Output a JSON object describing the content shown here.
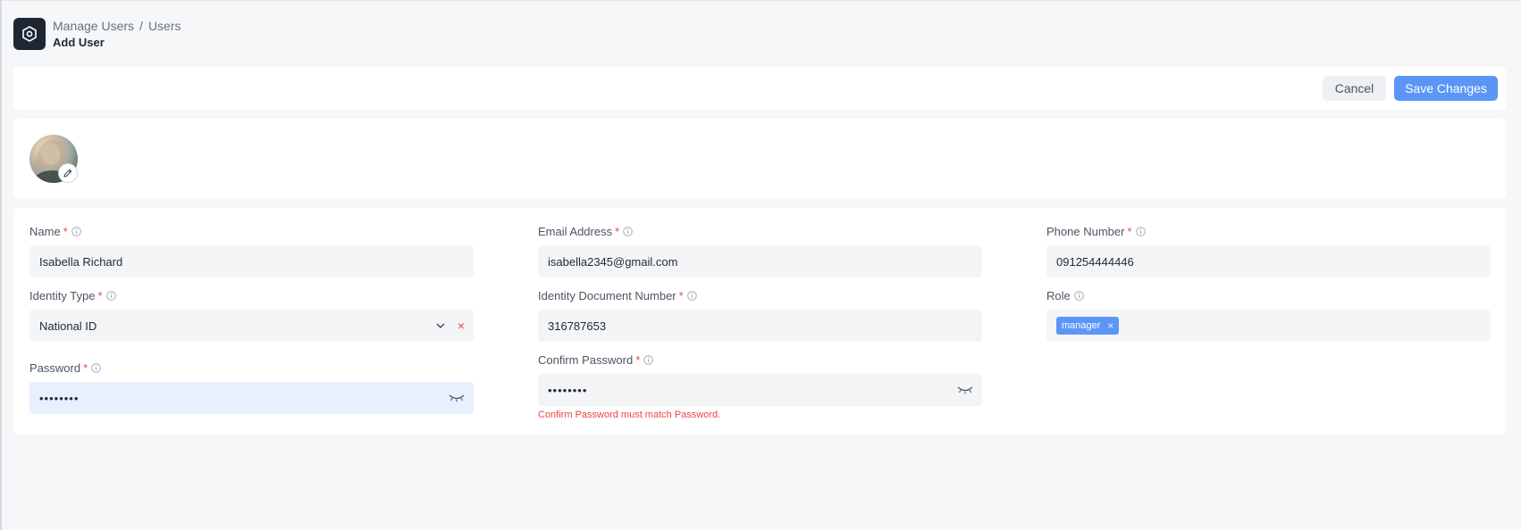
{
  "header": {
    "breadcrumb": [
      "Manage Users",
      "Users"
    ],
    "separator": "/",
    "title": "Add User"
  },
  "toolbar": {
    "cancel_label": "Cancel",
    "save_label": "Save Changes"
  },
  "form": {
    "required_mark": "*",
    "name": {
      "label": "Name",
      "value": "Isabella Richard"
    },
    "email": {
      "label": "Email Address",
      "value": "isabella2345@gmail.com"
    },
    "phone": {
      "label": "Phone Number",
      "value": "091254444446"
    },
    "identity_type": {
      "label": "Identity Type",
      "value": "National ID",
      "clear": "×"
    },
    "identity_doc": {
      "label": "Identity Document Number",
      "value": "316787653"
    },
    "role": {
      "label": "Role",
      "tags": [
        "manager"
      ],
      "remove": "×"
    },
    "password": {
      "label": "Password",
      "value": "••••••••"
    },
    "confirm_password": {
      "label": "Confirm Password",
      "value": "••••••••",
      "error": "Confirm Password must match Password."
    }
  },
  "colors": {
    "accent": "#5b96f7",
    "error": "#ef4444",
    "logo_bg": "#1f2633",
    "page_bg": "#f6f7f9"
  },
  "icons": [
    "app-logo-icon",
    "pencil-icon",
    "info-icon",
    "chevron-down-icon",
    "close-icon",
    "eye-closed-icon"
  ]
}
